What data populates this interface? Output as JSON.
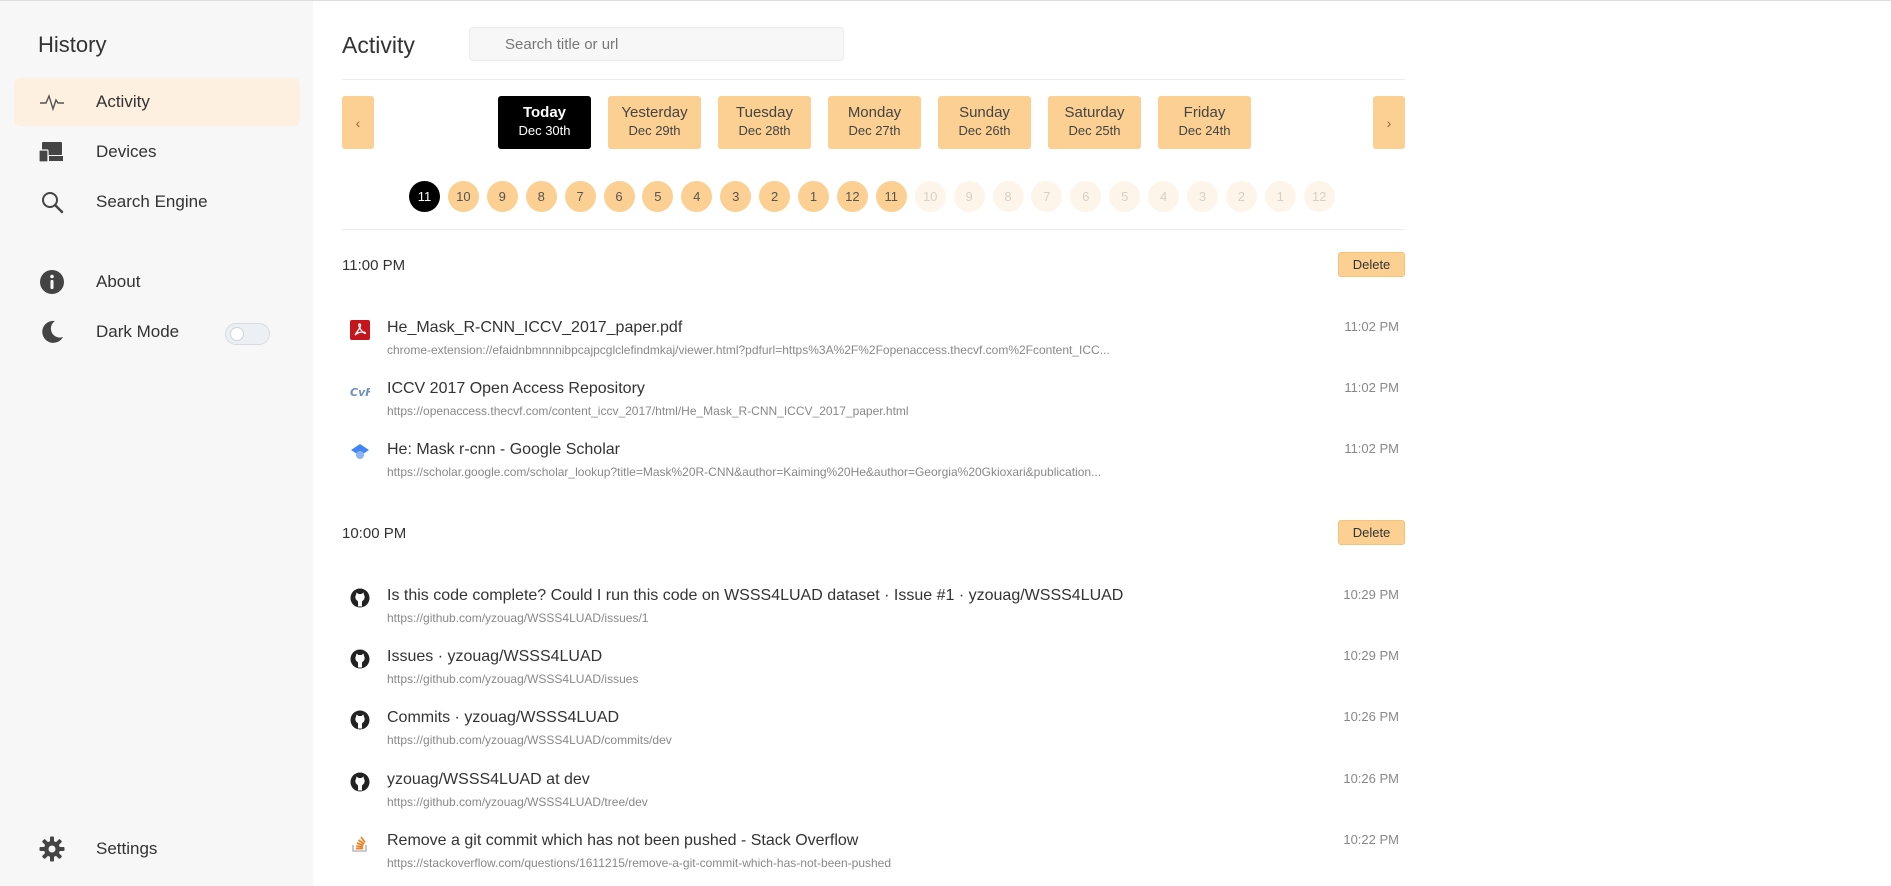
{
  "sidebar": {
    "title": "History",
    "items": [
      {
        "label": "Activity",
        "icon": "activity-icon",
        "active": true
      },
      {
        "label": "Devices",
        "icon": "devices-icon"
      },
      {
        "label": "Search Engine",
        "icon": "search-icon"
      },
      {
        "label": "About",
        "icon": "info-icon"
      },
      {
        "label": "Dark Mode",
        "icon": "moon-icon",
        "toggle": false
      }
    ],
    "settings_label": "Settings"
  },
  "main": {
    "title": "Activity",
    "search": {
      "placeholder": "Search title or url",
      "value": ""
    },
    "prev_arrow": "‹",
    "next_arrow": "›",
    "days": [
      {
        "name": "Today",
        "date": "Dec 30th",
        "active": true
      },
      {
        "name": "Yesterday",
        "date": "Dec 29th"
      },
      {
        "name": "Tuesday",
        "date": "Dec 28th"
      },
      {
        "name": "Monday",
        "date": "Dec 27th"
      },
      {
        "name": "Sunday",
        "date": "Dec 26th"
      },
      {
        "name": "Saturday",
        "date": "Dec 25th"
      },
      {
        "name": "Friday",
        "date": "Dec 24th"
      }
    ],
    "hours": [
      "11",
      "10",
      "9",
      "8",
      "7",
      "6",
      "5",
      "4",
      "3",
      "2",
      "1",
      "12",
      "11",
      "10",
      "9",
      "8",
      "7",
      "6",
      "5",
      "4",
      "3",
      "2",
      "1",
      "12"
    ],
    "hours_active_index": 0,
    "hours_enabled_count": 13,
    "groups": [
      {
        "label": "11:00 PM",
        "delete_label": "Delete",
        "entries": [
          {
            "title": "He_Mask_R-CNN_ICCV_2017_paper.pdf",
            "url": "chrome-extension://efaidnbmnnnibpcajpcglclefindmkaj/viewer.html?pdfurl=https%3A%2F%2Fopenaccess.thecvf.com%2Fcontent_ICC...",
            "time": "11:02 PM",
            "icon": "pdf-icon"
          },
          {
            "title": "ICCV 2017 Open Access Repository",
            "url": "https://openaccess.thecvf.com/content_iccv_2017/html/He_Mask_R-CNN_ICCV_2017_paper.html",
            "time": "11:02 PM",
            "icon": "cvf-icon"
          },
          {
            "title": "He: Mask r-cnn - Google Scholar",
            "url": "https://scholar.google.com/scholar_lookup?title=Mask%20R-CNN&author=Kaiming%20He&author=Georgia%20Gkioxari&publication...",
            "time": "11:02 PM",
            "icon": "scholar-icon"
          }
        ]
      },
      {
        "label": "10:00 PM",
        "delete_label": "Delete",
        "entries": [
          {
            "title": "Is this code complete? Could I run this code on WSSS4LUAD dataset · Issue #1 · yzouag/WSSS4LUAD",
            "url": "https://github.com/yzouag/WSSS4LUAD/issues/1",
            "time": "10:29 PM",
            "icon": "github-icon"
          },
          {
            "title": "Issues · yzouag/WSSS4LUAD",
            "url": "https://github.com/yzouag/WSSS4LUAD/issues",
            "time": "10:29 PM",
            "icon": "github-icon"
          },
          {
            "title": "Commits · yzouag/WSSS4LUAD",
            "url": "https://github.com/yzouag/WSSS4LUAD/commits/dev",
            "time": "10:26 PM",
            "icon": "github-icon"
          },
          {
            "title": "yzouag/WSSS4LUAD at dev",
            "url": "https://github.com/yzouag/WSSS4LUAD/tree/dev",
            "time": "10:26 PM",
            "icon": "github-icon"
          },
          {
            "title": "Remove a git commit which has not been pushed - Stack Overflow",
            "url": "https://stackoverflow.com/questions/1611215/remove-a-git-commit-which-has-not-been-pushed",
            "time": "10:22 PM",
            "icon": "stackoverflow-icon"
          }
        ]
      }
    ]
  },
  "colors": {
    "accent": "#fbd092",
    "active": "#000000",
    "sidebar_bg": "#f7f7f7",
    "active_nav_bg": "#fdf0e1"
  }
}
